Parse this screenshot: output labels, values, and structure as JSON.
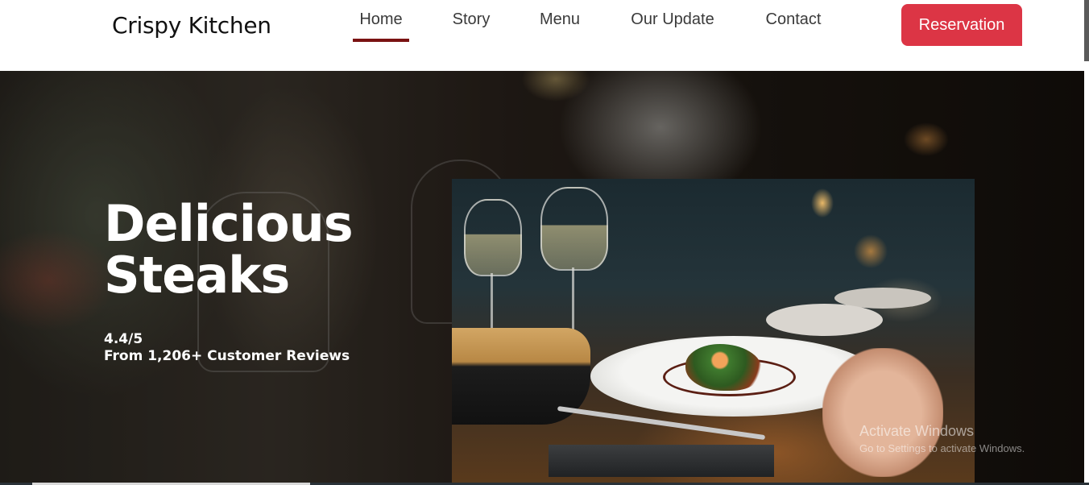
{
  "header": {
    "brand": "Crispy Kitchen",
    "nav": [
      {
        "label": "Home",
        "active": true
      },
      {
        "label": "Story",
        "active": false
      },
      {
        "label": "Menu",
        "active": false
      },
      {
        "label": "Our Update",
        "active": false
      },
      {
        "label": "Contact",
        "active": false
      }
    ],
    "reservation_label": "Reservation"
  },
  "hero": {
    "title": "Delicious Steaks",
    "rating": "4.4/5",
    "reviews": "From 1,206+ Customer Reviews"
  },
  "watermark": {
    "title": "Activate Windows",
    "subtitle": "Go to Settings to activate Windows."
  },
  "colors": {
    "accent": "#dc3545",
    "active_underline": "#7a1212",
    "text_dark": "#111111"
  }
}
